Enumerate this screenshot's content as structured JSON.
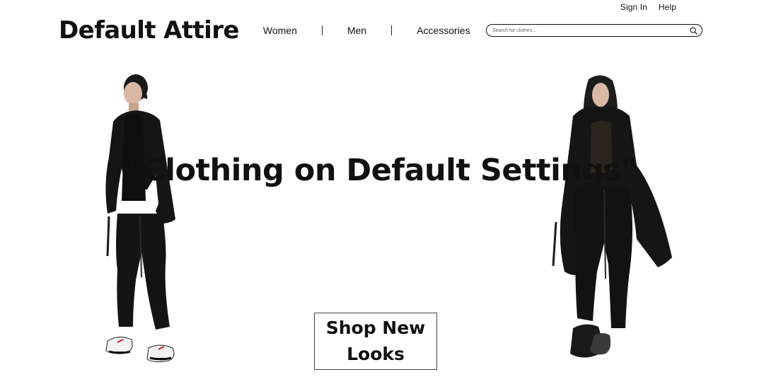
{
  "utility": {
    "sign_in": "Sign In",
    "help": "Help"
  },
  "header": {
    "logo": "Default Attire",
    "nav": [
      "Women",
      "Men",
      "Accessories"
    ],
    "search": {
      "placeholder": "Search for clothes...",
      "value": "",
      "icon": "search-icon"
    }
  },
  "hero": {
    "title": "\"Clothing on Default Settings\"",
    "cta_line1": "Shop New",
    "cta_line2": "Looks",
    "images": [
      "model-left",
      "model-right"
    ]
  },
  "colors": {
    "background": "#ffffff",
    "text": "#111111",
    "garment": "#141414"
  }
}
